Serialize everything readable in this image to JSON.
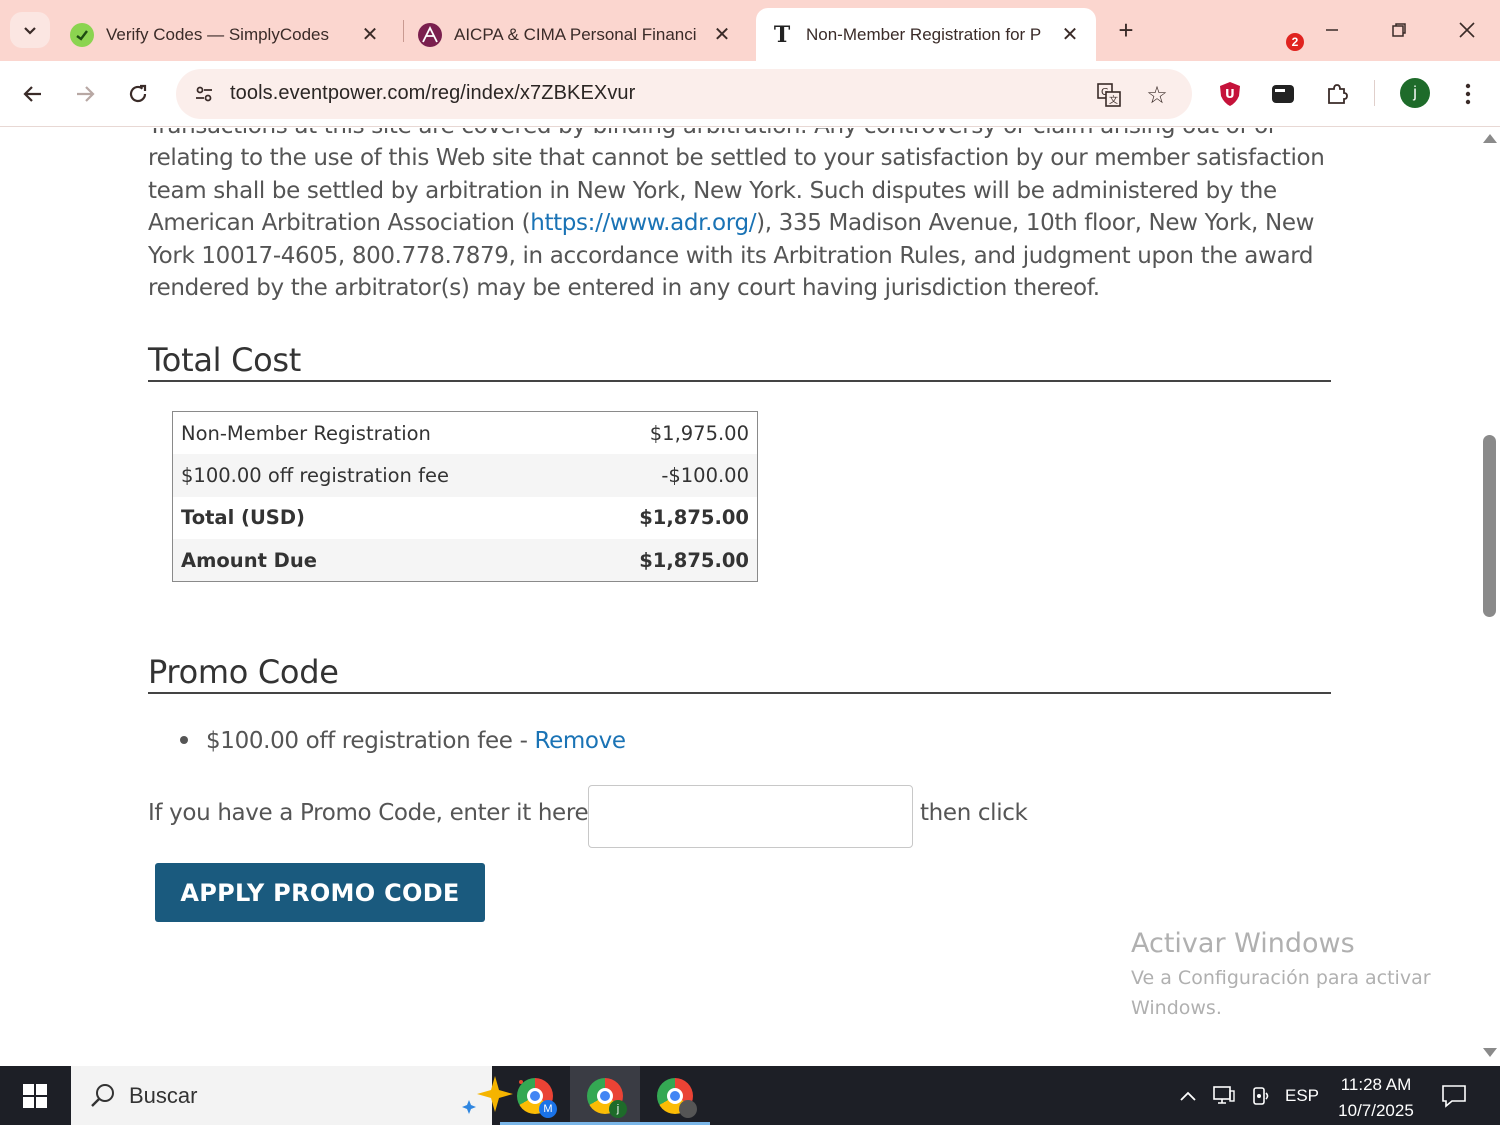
{
  "browser": {
    "tabs": [
      {
        "title": "Verify Codes — SimplyCodes",
        "favicon": "simplycodes-favicon",
        "active": false
      },
      {
        "title": "AICPA & CIMA Personal Financi",
        "favicon": "aicpa-favicon",
        "active": false
      },
      {
        "title": "Non-Member Registration for P",
        "favicon": "eventpower-favicon",
        "favicon_letter": "T",
        "active": true
      }
    ],
    "url": "tools.eventpower.com/reg/index/x7ZBKEXvur",
    "extension_badge": "2",
    "profile_initial": "j"
  },
  "page": {
    "arbitration": {
      "top_fragment": "Transactions at this site are covered by binding arbitration. Any controversy or claim arising out of or",
      "before_link": "relating to the use of this Web site that cannot be settled to your satisfaction by our member satisfaction team shall be settled by arbitration in New York, New York. Such disputes will be administered by the American Arbitration Association (",
      "link": "https://www.adr.org/",
      "after_link": "), 335 Madison Avenue, 10th floor, New York, New York 10017-4605, 800.778.7879, in accordance with its Arbitration Rules, and judgment upon the award rendered by the arbitrator(s) may be entered in any court having jurisdiction thereof."
    },
    "total_cost": {
      "heading": "Total Cost",
      "rows": [
        {
          "label": "Non-Member Registration",
          "amount": "$1,975.00",
          "bold": false
        },
        {
          "label": "$100.00 off registration fee",
          "amount": "-$100.00",
          "bold": false
        },
        {
          "label": "Total (USD)",
          "amount": "$1,875.00",
          "bold": true
        },
        {
          "label": "Amount Due",
          "amount": "$1,875.00",
          "bold": true
        }
      ]
    },
    "promo": {
      "heading": "Promo Code",
      "applied": "$100.00 off registration fee - ",
      "remove_label": "Remove",
      "prompt": "If you have a Promo Code, enter it here:",
      "input_value": "",
      "then_text": "then click",
      "button_label": "APPLY PROMO CODE"
    }
  },
  "watermark": {
    "line1": "Activar Windows",
    "line2": "Ve a Configuración para activar",
    "line3": "Windows."
  },
  "taskbar": {
    "search_text": "Buscar",
    "apps": [
      {
        "name": "chrome-profile-m",
        "badge": "M",
        "active": false
      },
      {
        "name": "chrome-profile-j",
        "badge": "j",
        "active": true
      },
      {
        "name": "chrome-profile-other",
        "badge": "",
        "active": false
      }
    ],
    "language": "ESP",
    "time": "11:28 AM",
    "date": "10/7/2025"
  }
}
